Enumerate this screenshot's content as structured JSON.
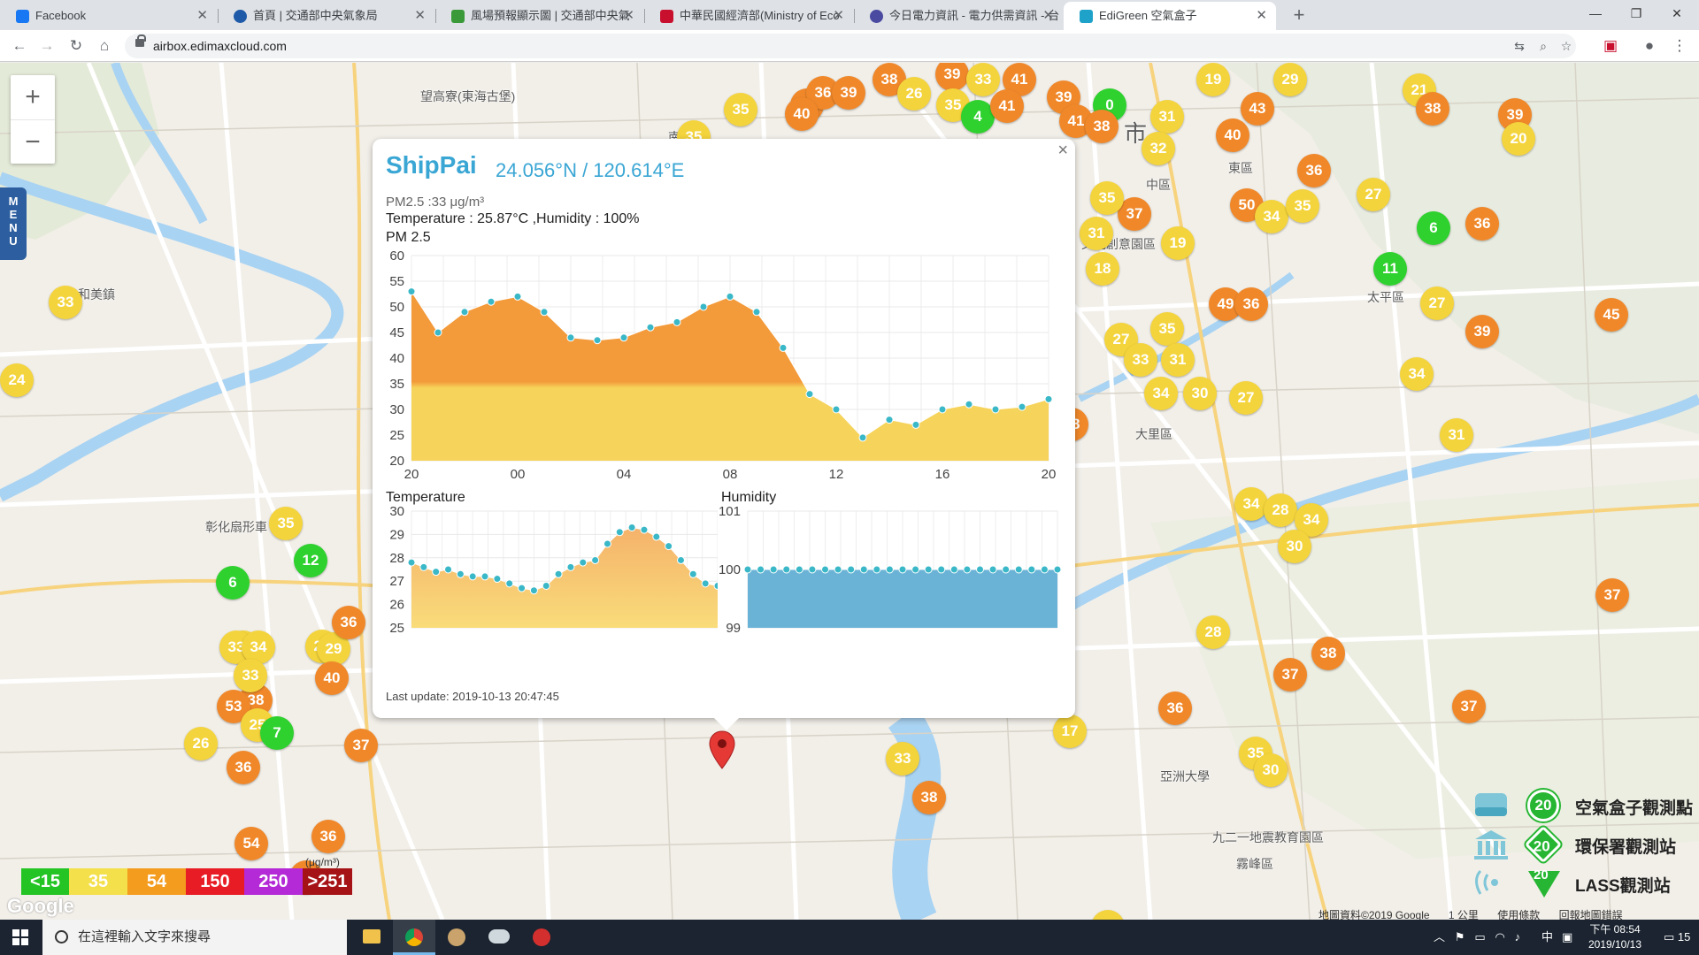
{
  "browser": {
    "tabs": [
      {
        "label": "Facebook",
        "color": "#1877f2",
        "active": false
      },
      {
        "label": "首頁 | 交通部中央氣象局",
        "color": "#1e5aa8",
        "active": false
      },
      {
        "label": "風場預報顯示圖 | 交通部中央氣",
        "color": "#3a9a3a",
        "active": false
      },
      {
        "label": "中華民國經濟部(Ministry of Eco",
        "color": "#c8102e",
        "active": false
      },
      {
        "label": "今日電力資訊 - 電力供需資訊 - 台",
        "color": "#4a4aa0",
        "active": false
      },
      {
        "label": "EdiGreen 空氣盒子",
        "color": "#1fa2c9",
        "active": true
      }
    ],
    "url": "airbox.edimaxcloud.com"
  },
  "map": {
    "zoom_in": "+",
    "zoom_out": "−",
    "menu_label": "MENU",
    "labels": [
      {
        "text": "望高寮(東海古堡)"
      },
      {
        "text": "和美鎮"
      },
      {
        "text": "彰化扇形車"
      },
      {
        "text": "中區"
      },
      {
        "text": "東區"
      },
      {
        "text": "太平區"
      },
      {
        "text": "大里區"
      },
      {
        "text": "霧峰區"
      },
      {
        "text": "亞洲大學"
      },
      {
        "text": "九二一地震教育園區"
      },
      {
        "text": "文化創意園區"
      },
      {
        "text": "南屯"
      },
      {
        "text": "市"
      }
    ],
    "scale_legend": [
      {
        "label": "<15",
        "color": "#23c423"
      },
      {
        "label": "35",
        "color": "#f4e04b"
      },
      {
        "label": "54",
        "color": "#f39c1e"
      },
      {
        "label": "150",
        "color": "#e81c24"
      },
      {
        "label": "250",
        "color": "#b32ad6"
      },
      {
        "label": ">251",
        "color": "#a61316"
      }
    ],
    "unit": "(μg/m³)",
    "google_logo": "Google",
    "attribution": [
      "地圖資料©2019 Google",
      "1 公里",
      "使用條款",
      "回報地圖錯誤"
    ],
    "legend": [
      {
        "badge": "20",
        "label": "空氣盒子觀測點"
      },
      {
        "badge": "20",
        "label": "環保署觀測站"
      },
      {
        "badge": "20",
        "label": "LASS觀測站"
      }
    ],
    "markers": [
      {
        "v": "38",
        "c": "#f0882a"
      },
      {
        "v": "35",
        "c": "#f4d43c"
      },
      {
        "v": "36",
        "c": "#f0882a"
      },
      {
        "v": "39",
        "c": "#f0882a"
      },
      {
        "v": "38",
        "c": "#f0882a"
      },
      {
        "v": "39",
        "c": "#f0882a"
      },
      {
        "v": "26",
        "c": "#f4d43c"
      },
      {
        "v": "35",
        "c": "#f4d43c"
      },
      {
        "v": "4",
        "c": "#2ed12e"
      },
      {
        "v": "33",
        "c": "#f4d43c"
      },
      {
        "v": "41",
        "c": "#f0882a"
      },
      {
        "v": "41",
        "c": "#f0882a"
      },
      {
        "v": "39",
        "c": "#f0882a"
      },
      {
        "v": "41",
        "c": "#f0882a"
      },
      {
        "v": "0",
        "c": "#2ed12e"
      },
      {
        "v": "38",
        "c": "#f0882a"
      },
      {
        "v": "31",
        "c": "#f4d43c"
      },
      {
        "v": "43",
        "c": "#f0882a"
      },
      {
        "v": "19",
        "c": "#f4d43c"
      },
      {
        "v": "29",
        "c": "#f4d43c"
      },
      {
        "v": "21",
        "c": "#f4d43c"
      },
      {
        "v": "32",
        "c": "#f4d43c"
      },
      {
        "v": "40",
        "c": "#f0882a"
      },
      {
        "v": "39",
        "c": "#f0882a"
      },
      {
        "v": "20",
        "c": "#f4d43c"
      },
      {
        "v": "36",
        "c": "#f0882a"
      },
      {
        "v": "27",
        "c": "#f4d43c"
      },
      {
        "v": "50",
        "c": "#f0882a"
      },
      {
        "v": "34",
        "c": "#f4d43c"
      },
      {
        "v": "35",
        "c": "#f4d43c"
      },
      {
        "v": "37",
        "c": "#f0882a"
      },
      {
        "v": "35",
        "c": "#f4d43c"
      },
      {
        "v": "6",
        "c": "#2ed12e"
      },
      {
        "v": "36",
        "c": "#f0882a"
      },
      {
        "v": "31",
        "c": "#f4d43c"
      },
      {
        "v": "19",
        "c": "#f4d43c"
      },
      {
        "v": "18",
        "c": "#f4d43c"
      },
      {
        "v": "11",
        "c": "#2ed12e"
      },
      {
        "v": "49",
        "c": "#f0882a"
      },
      {
        "v": "36",
        "c": "#f0882a"
      },
      {
        "v": "27",
        "c": "#f4d43c"
      },
      {
        "v": "45",
        "c": "#f0882a"
      },
      {
        "v": "35",
        "c": "#f4d43c"
      },
      {
        "v": "39",
        "c": "#f0882a"
      },
      {
        "v": "27",
        "c": "#f4d43c"
      },
      {
        "v": "33",
        "c": "#f4d43c"
      },
      {
        "v": "31",
        "c": "#f4d43c"
      },
      {
        "v": "34",
        "c": "#f4d43c"
      },
      {
        "v": "27",
        "c": "#f4d43c"
      },
      {
        "v": "34",
        "c": "#f4d43c"
      },
      {
        "v": "30",
        "c": "#f4d43c"
      },
      {
        "v": "31",
        "c": "#f4d43c"
      },
      {
        "v": "38",
        "c": "#f0882a"
      },
      {
        "v": "24",
        "c": "#f4d43c"
      },
      {
        "v": "34",
        "c": "#f4d43c"
      },
      {
        "v": "28",
        "c": "#f4d43c"
      },
      {
        "v": "34",
        "c": "#f4d43c"
      },
      {
        "v": "30",
        "c": "#f4d43c"
      },
      {
        "v": "37",
        "c": "#f0882a"
      },
      {
        "v": "28",
        "c": "#f4d43c"
      },
      {
        "v": "38",
        "c": "#f0882a"
      },
      {
        "v": "37",
        "c": "#f0882a"
      },
      {
        "v": "36",
        "c": "#f0882a"
      },
      {
        "v": "37",
        "c": "#f0882a"
      },
      {
        "v": "17",
        "c": "#f4d43c"
      },
      {
        "v": "35",
        "c": "#f4d43c"
      },
      {
        "v": "30",
        "c": "#f4d43c"
      },
      {
        "v": "33",
        "c": "#f4d43c"
      },
      {
        "v": "38",
        "c": "#f0882a"
      },
      {
        "v": "35",
        "c": "#f4d43c"
      },
      {
        "v": "12",
        "c": "#2ed12e"
      },
      {
        "v": "6",
        "c": "#2ed12e"
      },
      {
        "v": "35",
        "c": "#f4d43c"
      },
      {
        "v": "21",
        "c": "#f4d43c"
      },
      {
        "v": "29",
        "c": "#f4d43c"
      },
      {
        "v": "36",
        "c": "#f0882a"
      },
      {
        "v": "33",
        "c": "#f4d43c"
      },
      {
        "v": "34",
        "c": "#f4d43c"
      },
      {
        "v": "38",
        "c": "#f0882a"
      },
      {
        "v": "33",
        "c": "#f4d43c"
      },
      {
        "v": "40",
        "c": "#f0882a"
      },
      {
        "v": "53",
        "c": "#f0882a"
      },
      {
        "v": "25",
        "c": "#f4d43c"
      },
      {
        "v": "7",
        "c": "#2ed12e"
      },
      {
        "v": "26",
        "c": "#f4d43c"
      },
      {
        "v": "36",
        "c": "#f0882a"
      },
      {
        "v": "37",
        "c": "#f0882a"
      },
      {
        "v": "54",
        "c": "#f0882a"
      },
      {
        "v": "36",
        "c": "#f0882a"
      },
      {
        "v": "37",
        "c": "#f0882a"
      },
      {
        "v": "33",
        "c": "#f4d43c"
      },
      {
        "v": "38",
        "c": "#f0882a"
      },
      {
        "v": "35",
        "c": "#f4d43c"
      },
      {
        "v": "40",
        "c": "#f0882a"
      },
      {
        "v": "33",
        "c": "#f4d43c"
      }
    ]
  },
  "popup": {
    "title": "ShipPai",
    "coords": "24.056°N / 120.614°E",
    "pm_line": "PM2.5 :33 μg/m³",
    "th_line": "Temperature : 25.87°C ,Humidity : 100%",
    "pm_chart_label": "PM 2.5",
    "temp_chart_label": "Temperature",
    "hum_chart_label": "Humidity",
    "last_update": "Last update: 2019-10-13 20:47:45",
    "close": "×"
  },
  "chart_data": [
    {
      "type": "area",
      "title": "PM 2.5",
      "x_ticks": [
        "20",
        "00",
        "04",
        "08",
        "12",
        "16",
        "20"
      ],
      "y_ticks": [
        20,
        25,
        30,
        35,
        40,
        45,
        50,
        55,
        60
      ],
      "ylim": [
        20,
        60
      ],
      "threshold": 35,
      "colors": {
        "above": "#f39a3a",
        "below": "#f6d35a",
        "point": "#3ab8c8"
      },
      "values": [
        53,
        45,
        49,
        51,
        52,
        49,
        44,
        43.5,
        44,
        46,
        47,
        50,
        52,
        49,
        42,
        33,
        30,
        24.5,
        28,
        27,
        30,
        31,
        30,
        30.5,
        32
      ]
    },
    {
      "type": "area",
      "title": "Temperature",
      "y_ticks": [
        25,
        26,
        27,
        28,
        29,
        30
      ],
      "ylim": [
        25,
        30
      ],
      "colors": {
        "fill_top": "#f5b26b",
        "fill_bottom": "#f9dc7a",
        "point": "#3ab8c8"
      },
      "values": [
        27.8,
        27.6,
        27.4,
        27.5,
        27.3,
        27.2,
        27.2,
        27.1,
        26.9,
        26.7,
        26.6,
        26.8,
        27.3,
        27.6,
        27.8,
        27.9,
        28.6,
        29.1,
        29.3,
        29.2,
        28.9,
        28.5,
        27.9,
        27.3,
        26.9,
        26.8
      ]
    },
    {
      "type": "area",
      "title": "Humidity",
      "y_ticks": [
        99,
        100,
        101
      ],
      "ylim": [
        99,
        101
      ],
      "colors": {
        "fill": "#6bb3d6",
        "point": "#3ab8c8"
      },
      "values": [
        100,
        100,
        100,
        100,
        100,
        100,
        100,
        100,
        100,
        100,
        100,
        100,
        100,
        100,
        100,
        100,
        100,
        100,
        100,
        100,
        100,
        100,
        100,
        100,
        100
      ]
    }
  ],
  "taskbar": {
    "search_placeholder": "在這裡輸入文字來搜尋",
    "tray_ime": "中",
    "time": "下午 08:54",
    "date": "2019/10/13",
    "notification": "15"
  }
}
